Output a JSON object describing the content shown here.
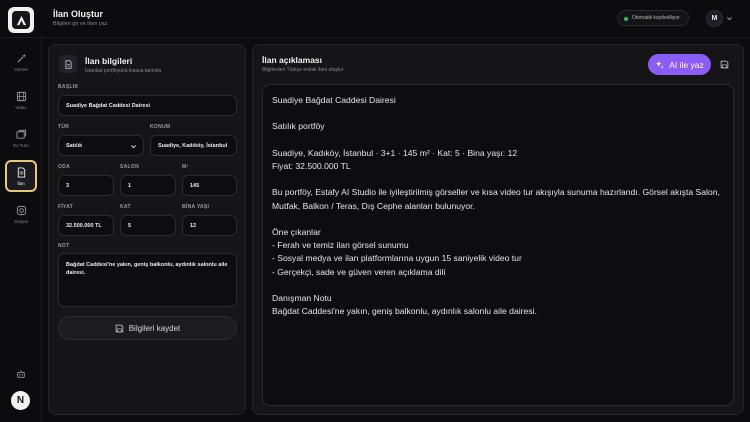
{
  "header": {
    "title": "İlan Oluştur",
    "subtitle": "Bilgileri gir ve ilanı yaz",
    "autosave": "Otomatik kaydediliyor",
    "avatar_initial": "M"
  },
  "sidebar": {
    "items": [
      {
        "label": "Görsel",
        "icon": "sparkle-wand-icon"
      },
      {
        "label": "Video",
        "icon": "film-icon"
      },
      {
        "label": "Ev Turu",
        "icon": "gallery-icon"
      },
      {
        "label": "İlan",
        "icon": "document-icon",
        "active": true
      },
      {
        "label": "Sosyal",
        "icon": "instagram-icon"
      }
    ],
    "bottom_logo": "N"
  },
  "left_panel": {
    "title": "İlan bilgileri",
    "subtitle": "İstanbul portföyünü kısaca tanımla",
    "labels": {
      "baslik": "BAŞLIK",
      "tur": "TÜR",
      "konum": "KONUM",
      "oda": "ODA",
      "salon": "SALON",
      "m2": "M²",
      "fiyat": "FİYAT",
      "kat": "KAT",
      "bina_yasi": "BİNA YAŞI",
      "not": "NOT"
    },
    "values": {
      "baslik": "Suadiye Bağdat Caddesi Dairesi",
      "tur": "Satılık",
      "konum": "Suadiye, Kadıköy, İstanbul",
      "oda": "3",
      "salon": "1",
      "m2": "145",
      "fiyat": "32.500.000 TL",
      "kat": "5",
      "bina_yasi": "12",
      "not": "Bağdat Caddesi'ne yakın, geniş balkonlu, aydınlık salonlu aile dairesi."
    },
    "save_label": "Bilgileri kaydet"
  },
  "right_panel": {
    "title": "İlan açıklaması",
    "subtitle": "Bilgilerden Türkçe emlak ilanı oluştur",
    "ai_button": "AI ile yaz",
    "description": "Suadiye Bağdat Caddesi Dairesi\n\nSatılık portföy\n\nSuadiye, Kadıköy, İstanbul · 3+1 · 145 m² · Kat: 5 · Bina yaşı: 12\nFiyat: 32.500.000 TL\n\nBu portföy, Estafy AI Studio ile iyileştirilmiş görseller ve kısa video tur akışıyla sunuma hazırlandı. Görsel akışta Salon, Mutfak, Balkon / Teras, Dış Cephe alanları bulunuyor.\n\nÖne çıkanlar\n- Ferah ve temiz ilan görsel sunumu\n- Sosyal medya ve ilan platformlarına uygun 15 saniyelik video tur\n- Gerçekçi, sade ve güven veren açıklama dili\n\nDanışman Notu\nBağdat Caddesi'ne yakın, geniş balkonlu, aydınlık salonlu aile dairesi."
  },
  "colors": {
    "accent": "#8b5cf6",
    "active_border": "#e7c77a",
    "status_green": "#22c55e",
    "background": "#0c0c0e",
    "panel": "#151518"
  }
}
